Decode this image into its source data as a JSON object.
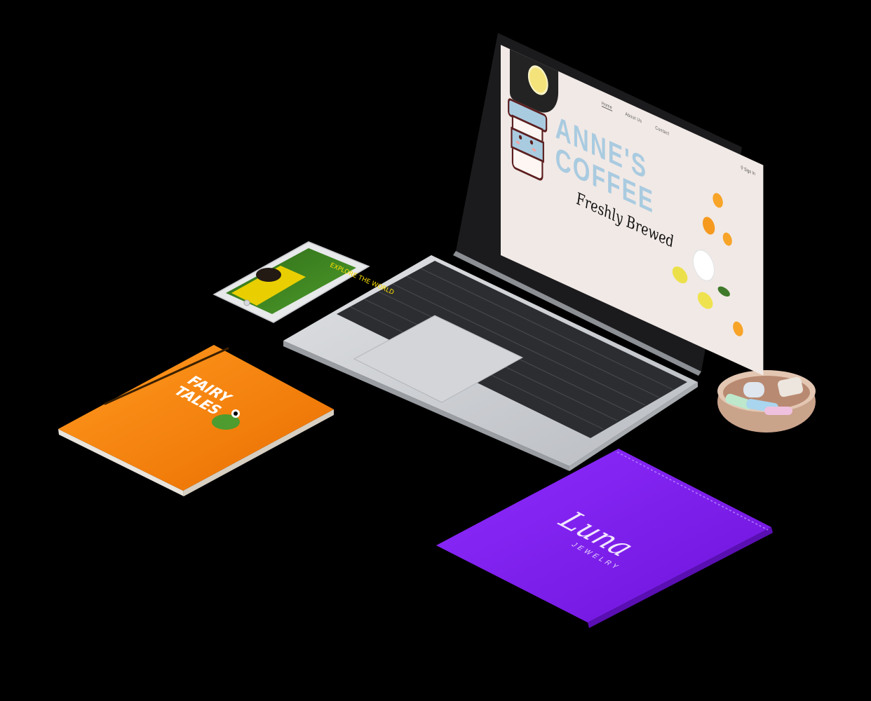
{
  "laptop_site": {
    "nav": [
      "Home",
      "About Us",
      "Contact"
    ],
    "signin": "Sign In",
    "brand_line1": "ANNE'S",
    "brand_line2": "COFFEE",
    "tagline": "Freshly Brewed"
  },
  "phone_app": {
    "banner": "EXPLORE THE WORLD"
  },
  "notebook": {
    "title_line1": "FAIRY",
    "title_line2": "TALES"
  },
  "pouch": {
    "logo": "Luna",
    "subtitle": "JEWELRY"
  },
  "colors": {
    "background": "#000000",
    "laptop_body": "#c9ccd1",
    "screen_bg": "#f1e9e6",
    "brand_blue": "#a9cbe0",
    "book_orange": "#f57c00",
    "pouch_purple": "#7d1ee6",
    "phone_green": "#3a7a1f",
    "phone_yellow": "#f2d300"
  }
}
